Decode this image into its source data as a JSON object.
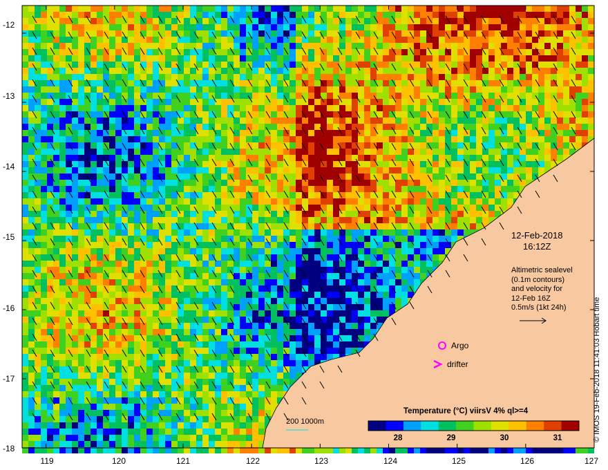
{
  "map": {
    "lon_ticks": [
      119,
      120,
      121,
      122,
      123,
      124,
      125,
      126,
      127
    ],
    "lat_ticks": [
      -12,
      -13,
      -14,
      -15,
      -16,
      -17,
      -18
    ],
    "lon_range": [
      118.65,
      127.0
    ],
    "lat_range": [
      -11.6,
      -18.0
    ]
  },
  "annotations": {
    "date": "12-Feb-2018",
    "time": "16:12Z",
    "altimetry_line1": "Altimetric sealevel",
    "altimetry_line2": "(0.1m contours)",
    "altimetry_line3": "and velocity for",
    "altimetry_line4": "12-Feb 16Z",
    "altimetry_line5": "0.5m/s (1kt 24h)"
  },
  "legend": {
    "argo": "Argo",
    "drifter": "drifter",
    "contour_label": "200  1000m",
    "argo_color": "#ff00ff",
    "drifter_color": "#ff00ff",
    "contour_color": "#40e0d0"
  },
  "colorbar": {
    "title": "Temperature (°C) viirsV 4% ql>=4",
    "ticks": [
      "28",
      "29",
      "30",
      "31"
    ],
    "min": 27.3,
    "max": 31.6,
    "colors": [
      "#000080",
      "#0000ff",
      "#00a0ff",
      "#00e0e0",
      "#00c060",
      "#40d020",
      "#a0e000",
      "#e0e000",
      "#ffc000",
      "#ff8000",
      "#e04000",
      "#a00000"
    ]
  },
  "land_color": "#f8c8a0",
  "credit": "© IMOS 19-Feb-2018 11:41:03 Hobart time"
}
